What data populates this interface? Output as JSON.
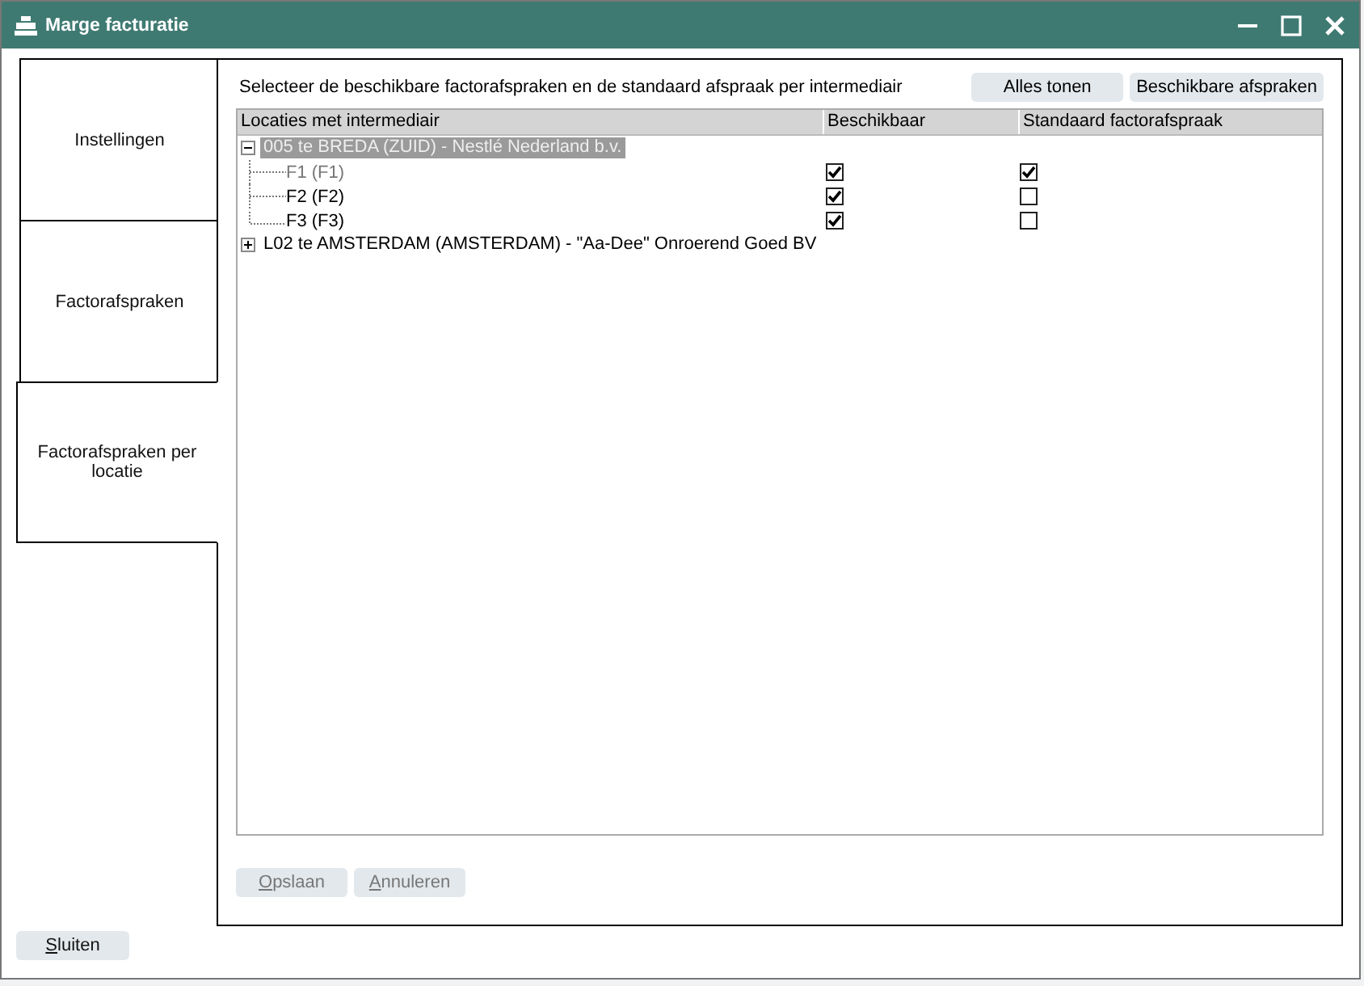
{
  "window": {
    "title": "Marge facturatie"
  },
  "tabs": [
    {
      "label": "Instellingen",
      "selected": false
    },
    {
      "label": "Factorafspraken",
      "selected": false
    },
    {
      "label": "Factorafspraken per locatie",
      "selected": true
    }
  ],
  "instruction": "Selecteer de beschikbare factorafspraken en de standaard afspraak per intermediair",
  "filter_buttons": [
    "Alles tonen",
    "Beschikbare afspraken"
  ],
  "table": {
    "columns": [
      "Locaties met intermediair",
      "Beschikbaar",
      "Standaard factorafspraak"
    ],
    "rows": [
      {
        "label": "005 te BREDA (ZUID) - Nestlé Nederland b.v.",
        "expanded": true,
        "selected": true,
        "children": [
          {
            "label": "F1 (F1)",
            "greyed": true,
            "available": true,
            "standard": true
          },
          {
            "label": "F2 (F2)",
            "greyed": false,
            "available": true,
            "standard": false
          },
          {
            "label": "F3 (F3)",
            "greyed": false,
            "available": true,
            "standard": false
          }
        ]
      },
      {
        "label": "L02 te AMSTERDAM (AMSTERDAM) - \"Aa-Dee\" Onroerend Goed BV",
        "expanded": false,
        "selected": false,
        "children": []
      }
    ]
  },
  "actions": [
    {
      "label": "Opslaan",
      "disabled": true
    },
    {
      "label": "Annuleren",
      "disabled": true
    }
  ],
  "close_button": "Sluiten"
}
